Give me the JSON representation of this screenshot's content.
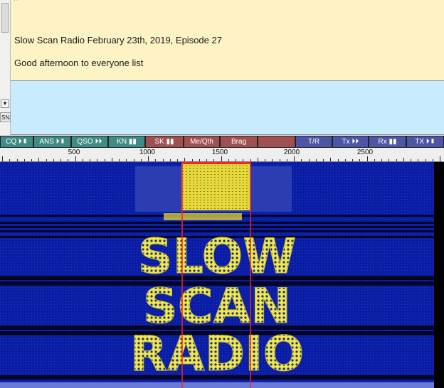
{
  "rx": {
    "lines": [
      "Slow Scan Radio February 23th, 2019, Episode 27",
      "Good afternoon to everyone list"
    ],
    "top_mark": "^"
  },
  "tx": {
    "scroll_down_glyph": "▼",
    "side_label": "SNJ"
  },
  "macros": [
    {
      "label": "CQ ⏵▮",
      "color": "teal"
    },
    {
      "label": "ANS ⏵▮",
      "color": "teal"
    },
    {
      "label": "QSO ⏵⏵",
      "color": "teal"
    },
    {
      "label": "KN ▮▮",
      "color": "teal"
    },
    {
      "label": "SK ▮▮",
      "color": "red"
    },
    {
      "label": "Me/Qth",
      "color": "red"
    },
    {
      "label": "Brag",
      "color": "red"
    },
    {
      "label": "",
      "color": "red"
    },
    {
      "label": "T/R",
      "color": "blue"
    },
    {
      "label": "Tx ⏵⏵",
      "color": "blue"
    },
    {
      "label": "Rx ▮▮",
      "color": "blue"
    },
    {
      "label": "TX ⏵▮",
      "color": "blue"
    }
  ],
  "scale": {
    "labels": [
      "500",
      "1000",
      "1500",
      "2000",
      "2500"
    ]
  },
  "waterfall": {
    "text_lines": [
      "SLOW",
      "SCAN",
      "RADIO"
    ],
    "colors": {
      "background": "#0a1fa8",
      "signal": "#f0e84a",
      "cursor": "#ff2020"
    }
  }
}
